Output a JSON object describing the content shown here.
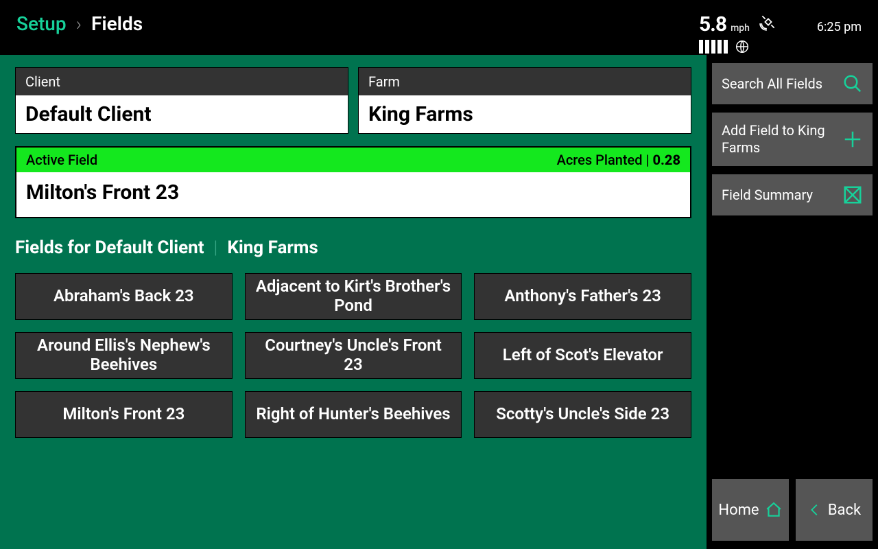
{
  "breadcrumb": {
    "parent": "Setup",
    "current": "Fields"
  },
  "status": {
    "speed": "5.8",
    "speed_unit": "mph",
    "time": "6:25 pm"
  },
  "client": {
    "label": "Client",
    "value": "Default Client"
  },
  "farm": {
    "label": "Farm",
    "value": "King Farms"
  },
  "active": {
    "label": "Active Field",
    "acres_label": "Acres Planted",
    "acres_value": "0.28",
    "name": "Milton's Front 23"
  },
  "list_heading": {
    "prefix": "Fields for Default Client",
    "suffix": "King Farms"
  },
  "fields": [
    "Abraham's Back 23",
    "Adjacent to Kirt's Brother's Pond",
    "Anthony's Father's 23",
    "Around Ellis's Nephew's Beehives",
    "Courtney's Uncle's Front 23",
    "Left of Scot's Elevator",
    "Milton's Front 23",
    "Right of Hunter's Beehives",
    "Scotty's Uncle's Side 23"
  ],
  "sidebar": {
    "search": "Search All Fields",
    "add": "Add Field to King Farms",
    "summary": "Field Summary"
  },
  "nav": {
    "home": "Home",
    "back": "Back"
  }
}
